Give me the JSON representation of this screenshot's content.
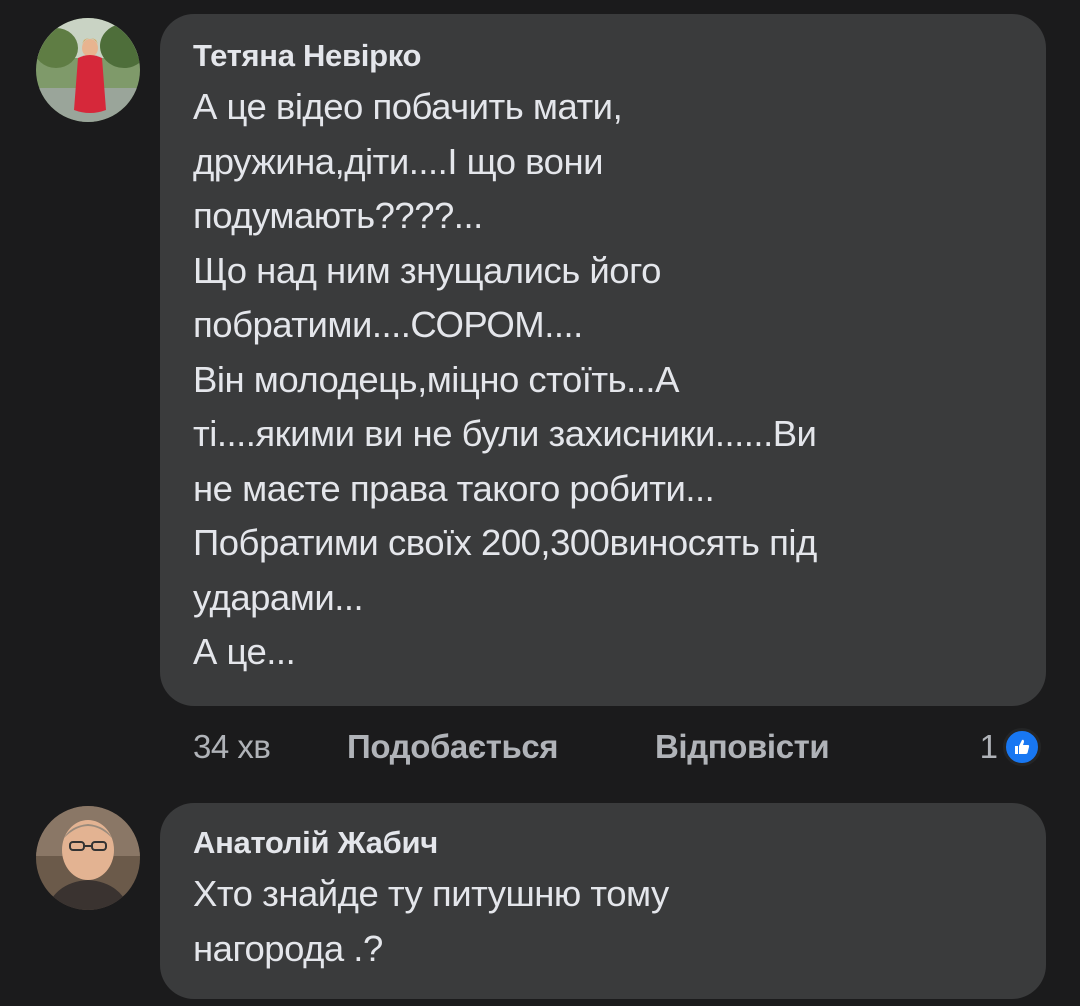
{
  "comments": [
    {
      "author": "Тетяна Невірко",
      "lines": [
        "А це відео побачить мати,",
        "дружина,діти....І що вони",
        "подумають????...",
        "Що над ним знущались його",
        "побратими....СОРОМ....",
        "Він молодець,міцно стоїть...А",
        "ті....якими ви не були захисники......Ви",
        "не маєте права такого робити...",
        "Побратими своїх 200,300виносять під",
        "ударами...",
        "А це..."
      ],
      "time": "34 хв",
      "like_label": "Подобається",
      "reply_label": "Відповісти",
      "reaction_count": "1",
      "reaction_icon": "thumbs-up-icon"
    },
    {
      "author": "Анатолій Жабич",
      "lines": [
        "Хто знайде ту питушню тому",
        "нагорода .?"
      ]
    }
  ],
  "colors": {
    "background": "#1b1b1c",
    "bubble": "#3a3b3c",
    "text": "#e4e6eb",
    "secondary_text": "#b0b3b8",
    "like_blue": "#1877f2"
  }
}
